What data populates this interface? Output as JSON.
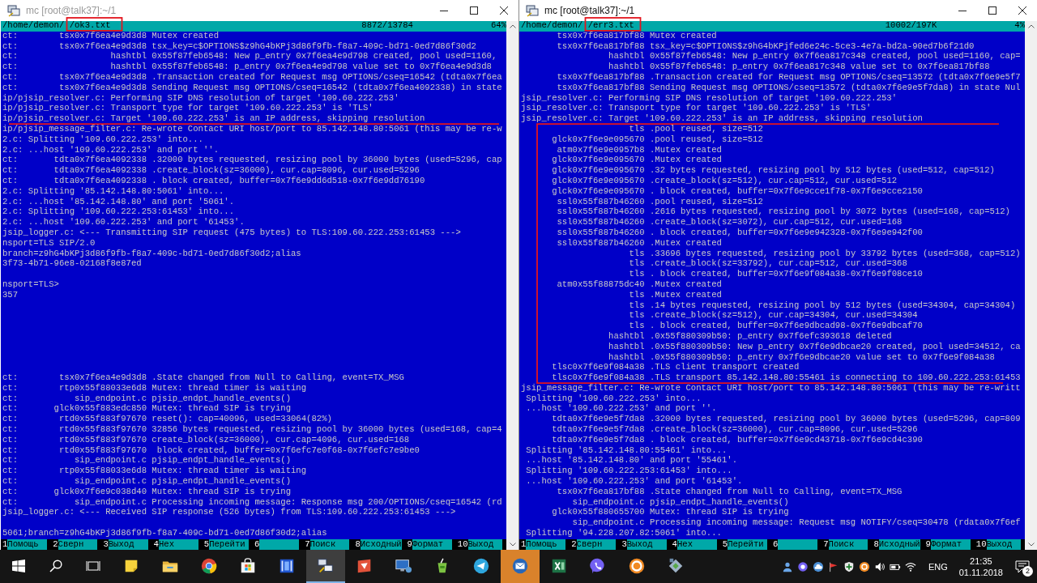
{
  "windows": [
    {
      "title": "mc [root@talk37]:~/1",
      "active": false,
      "header": {
        "path_start": "/home/demon/",
        "path_end": "/ok3.txt",
        "position": "8872/13784",
        "percent": "64%"
      },
      "lines": [
        {
          "kind": "text",
          "text": "ct:        tsx0x7f6ea4e9d3d8 Mutex created"
        },
        {
          "kind": "text",
          "text": "ct:        tsx0x7f6ea4e9d3d8 tsx_key=c$OPTIONS$z9hG4bKPj3d86f9fb-f8a7-409c-bd71-0ed7d86f30d2"
        },
        {
          "kind": "text",
          "text": "ct:                  hashtbl 0x55f87feb6548: New p_entry 0x7f6ea4e9d798 created, pool used=1160,"
        },
        {
          "kind": "text",
          "text": "ct:                  hashtbl 0x55f87feb6548: p_entry 0x7f6ea4e9d798 value set to 0x7f6ea4e9d3d8"
        },
        {
          "kind": "text",
          "text": "ct:        tsx0x7f6ea4e9d3d8 .Transaction created for Request msg OPTIONS/cseq=16542 (tdta0x7f6ea"
        },
        {
          "kind": "text",
          "text": "ct:        tsx0x7f6ea4e9d3d8 Sending Request msg OPTIONS/cseq=16542 (tdta0x7f6ea4092338) in state"
        },
        {
          "kind": "text",
          "text": "ip/pjsip_resolver.c: Performing SIP DNS resolution of target '109.60.222.253'"
        },
        {
          "kind": "text",
          "text": "ip/pjsip_resolver.c: Transport type for target '109.60.222.253' is 'TLS'"
        },
        {
          "kind": "text",
          "text": "ip/pjsip_resolver.c: Target '109.60.222.253' is an IP address, skipping resolution"
        },
        {
          "kind": "text",
          "text": "ip/pjsip_message_filter.c: Re-wrote Contact URI host/port to 85.142.148.80:5061 (this may be re-w"
        },
        {
          "kind": "text",
          "text": "2.c: Splitting '109.60.222.253' into..."
        },
        {
          "kind": "text",
          "text": "2.c: ...host '109.60.222.253' and port ''."
        },
        {
          "kind": "text",
          "text": "ct:       tdta0x7f6ea4092338 .32000 bytes requested, resizing pool by 36000 bytes (used=5296, cap"
        },
        {
          "kind": "text",
          "text": "ct:       tdta0x7f6ea4092338 .create_block(sz=36000), cur.cap=8096, cur.used=5296"
        },
        {
          "kind": "text",
          "text": "ct:       tdta0x7f6ea4092338 . block created, buffer=0x7f6e9dd6d518-0x7f6e9dd76190"
        },
        {
          "kind": "text",
          "text": "2.c: Splitting '85.142.148.80:5061' into..."
        },
        {
          "kind": "text",
          "text": "2.c: ...host '85.142.148.80' and port '5061'."
        },
        {
          "kind": "text",
          "text": "2.c: Splitting '109.60.222.253:61453' into..."
        },
        {
          "kind": "text",
          "text": "2.c: ...host '109.60.222.253' and port '61453'."
        },
        {
          "kind": "text",
          "text": "jsip_logger.c: <--- Transmitting SIP request (475 bytes) to TLS:109.60.222.253:61453 --->"
        },
        {
          "kind": "text",
          "text": "nsport=TLS SIP/2.0"
        },
        {
          "kind": "text",
          "text": "branch=z9hG4bKPj3d86f9fb-f8a7-409c-bd71-0ed7d86f30d2;alias"
        },
        {
          "kind": "text",
          "text": "3f73-4b71-96e8-02168f8e87ed"
        },
        {
          "kind": "blank"
        },
        {
          "kind": "text",
          "text": "nsport=TLS>"
        },
        {
          "kind": "text",
          "text": "357"
        },
        {
          "kind": "blank"
        },
        {
          "kind": "blank"
        },
        {
          "kind": "blank"
        },
        {
          "kind": "blank"
        },
        {
          "kind": "blank"
        },
        {
          "kind": "blank"
        },
        {
          "kind": "blank"
        },
        {
          "kind": "text",
          "text": "ct:        tsx0x7f6ea4e9d3d8 .State changed from Null to Calling, event=TX_MSG"
        },
        {
          "kind": "text",
          "text": "ct:        rtp0x55f88033e6d8 Mutex: thread timer is waiting"
        },
        {
          "kind": "text",
          "text": "ct:           sip_endpoint.c pjsip_endpt_handle_events()"
        },
        {
          "kind": "text",
          "text": "ct:       glck0x55f883edc850 Mutex: thread SIP is trying"
        },
        {
          "kind": "text",
          "text": "ct:        rtd0x55f883f97670 reset(): cap=40096, used=33064(82%)"
        },
        {
          "kind": "text",
          "text": "ct:        rtd0x55f883f97670 32856 bytes requested, resizing pool by 36000 bytes (used=168, cap=4"
        },
        {
          "kind": "text",
          "text": "ct:        rtd0x55f883f97670 create_block(sz=36000), cur.cap=4096, cur.used=168"
        },
        {
          "kind": "text",
          "text": "ct:        rtd0x55f883f97670  block created, buffer=0x7f6efc7e0f68-0x7f6efc7e9be0"
        },
        {
          "kind": "text",
          "text": "ct:           sip_endpoint.c pjsip_endpt_handle_events()"
        },
        {
          "kind": "text",
          "text": "ct:        rtp0x55f88033e6d8 Mutex: thread timer is waiting"
        },
        {
          "kind": "text",
          "text": "ct:           sip_endpoint.c pjsip_endpt_handle_events()"
        },
        {
          "kind": "text",
          "text": "ct:       glck0x7f6e9c038d40 Mutex: thread SIP is trying"
        },
        {
          "kind": "text",
          "text": "ct:           sip_endpoint.c Processing incoming message: Response msg 200/OPTIONS/cseq=16542 (rd"
        },
        {
          "kind": "text",
          "text": "jsip_logger.c: <--- Received SIP response (526 bytes) from TLS:109.60.222.253:61453 --->"
        },
        {
          "kind": "blank"
        },
        {
          "kind": "text",
          "text": "5061;branch=z9hG4bKPj3d86f9fb-f8a7-409c-bd71-0ed7d86f30d2;alias"
        }
      ],
      "fkeys": [
        {
          "number": "1",
          "label": "Помощь"
        },
        {
          "number": "2",
          "label": "Сверн"
        },
        {
          "number": "3",
          "label": "Выход"
        },
        {
          "number": "4",
          "label": "Hex"
        },
        {
          "number": "5",
          "label": "Перейти"
        },
        {
          "number": "6"
        },
        {
          "number": "7",
          "label": "Поиск"
        },
        {
          "number": "8",
          "label": "Исходный"
        },
        {
          "number": "9",
          "label": "Формат"
        },
        {
          "number": "10",
          "label": "Выход"
        }
      ],
      "marks": [
        {
          "kind": "frame"
        },
        {
          "kind": "underline"
        }
      ]
    },
    {
      "title": "mc [root@talk37]:~/1",
      "active": true,
      "header": {
        "path_start": "/home/demon/",
        "path_end": "/err3.txt",
        "position": "10002/197K",
        "percent": "4%"
      },
      "lines": [
        {
          "kind": "text",
          "text": "       tsx0x7f6ea817bf88 Mutex created"
        },
        {
          "kind": "text",
          "text": "       tsx0x7f6ea817bf88 tsx_key=c$OPTIONS$z9hG4bKPjfed6e24c-5ce3-4e7a-bd2a-90ed7b6f21d0"
        },
        {
          "kind": "text",
          "text": "                 hashtbl 0x55f87feb6548: New p_entry 0x7f6ea817c348 created, pool used=1160, cap="
        },
        {
          "kind": "text",
          "text": "                 hashtbl 0x55f87feb6548: p_entry 0x7f6ea817c348 value set to 0x7f6ea817bf88"
        },
        {
          "kind": "text",
          "text": "       tsx0x7f6ea817bf88 .Transaction created for Request msg OPTIONS/cseq=13572 (tdta0x7f6e9e5f7"
        },
        {
          "kind": "text",
          "text": "       tsx0x7f6ea817bf88 Sending Request msg OPTIONS/cseq=13572 (tdta0x7f6e9e5f7da8) in state Nul"
        },
        {
          "kind": "text",
          "text": "jsip_resolver.c: Performing SIP DNS resolution of target '109.60.222.253'"
        },
        {
          "kind": "text",
          "text": "jsip_resolver.c: Transport type for target '109.60.222.253' is 'TLS'"
        },
        {
          "kind": "text",
          "text": "jsip_resolver.c: Target '109.60.222.253' is an IP address, skipping resolution"
        },
        {
          "kind": "text",
          "text": "                     tls .pool reused, size=512"
        },
        {
          "kind": "text",
          "text": "      glck0x7f6e9e095670 .pool reused, size=512"
        },
        {
          "kind": "text",
          "text": "       atm0x7f6e9e0957b8 .Mutex created"
        },
        {
          "kind": "text",
          "text": "      glck0x7f6e9e095670 .Mutex created"
        },
        {
          "kind": "text",
          "text": "      glck0x7f6e9e095670 .32 bytes requested, resizing pool by 512 bytes (used=512, cap=512)"
        },
        {
          "kind": "text",
          "text": "      glck0x7f6e9e095670 .create_block(sz=512), cur.cap=512, cur.used=512"
        },
        {
          "kind": "text",
          "text": "      glck0x7f6e9e095670 . block created, buffer=0x7f6e9cce1f78-0x7f6e9cce2150"
        },
        {
          "kind": "text",
          "text": "       ssl0x55f887b46260 .pool reused, size=512"
        },
        {
          "kind": "text",
          "text": "       ssl0x55f887b46260 .2616 bytes requested, resizing pool by 3072 bytes (used=168, cap=512)"
        },
        {
          "kind": "text",
          "text": "       ssl0x55f887b46260 .create_block(sz=3072), cur.cap=512, cur.used=168"
        },
        {
          "kind": "text",
          "text": "       ssl0x55f887b46260 . block created, buffer=0x7f6e9e942328-0x7f6e9e942f00"
        },
        {
          "kind": "text",
          "text": "       ssl0x55f887b46260 .Mutex created"
        },
        {
          "kind": "text",
          "text": "                     tls .33696 bytes requested, resizing pool by 33792 bytes (used=368, cap=512)"
        },
        {
          "kind": "text",
          "text": "                     tls .create_block(sz=33792), cur.cap=512, cur.used=368"
        },
        {
          "kind": "text",
          "text": "                     tls . block created, buffer=0x7f6e9f084a38-0x7f6e9f08ce10"
        },
        {
          "kind": "text",
          "text": "       atm0x55f88875dc40 .Mutex created"
        },
        {
          "kind": "text",
          "text": "                     tls .Mutex created"
        },
        {
          "kind": "text",
          "text": "                     tls .14 bytes requested, resizing pool by 512 bytes (used=34304, cap=34304)"
        },
        {
          "kind": "text",
          "text": "                     tls .create_block(sz=512), cur.cap=34304, cur.used=34304"
        },
        {
          "kind": "text",
          "text": "                     tls . block created, buffer=0x7f6e9dbcad98-0x7f6e9dbcaf70"
        },
        {
          "kind": "text",
          "text": "                 hashtbl .0x55f880309b50: p_entry 0x7f6efc393618 deleted"
        },
        {
          "kind": "text",
          "text": "                 hashtbl .0x55f880309b50: New p_entry 0x7f6e9dbcae20 created, pool used=34512, ca"
        },
        {
          "kind": "text",
          "text": "                 hashtbl .0x55f880309b50: p_entry 0x7f6e9dbcae20 value set to 0x7f6e9f084a38"
        },
        {
          "kind": "text",
          "text": "      tlsc0x7f6e9f084a38 .TLS client transport created"
        },
        {
          "kind": "text",
          "text": "      tlsc0x7f6e9f084a38 .TLS transport 85.142.148.80:55461 is connecting to 109.60.222.253:61453"
        },
        {
          "kind": "text",
          "text": "jsip_message_filter.c: Re-wrote Contact URI host/port to 85.142.148.80:5061 (this may be re-writt"
        },
        {
          "kind": "text",
          "text": " Splitting '109.60.222.253' into..."
        },
        {
          "kind": "text",
          "text": " ...host '109.60.222.253' and port ''."
        },
        {
          "kind": "text",
          "text": "      tdta0x7f6e9e5f7da8 .32000 bytes requested, resizing pool by 36000 bytes (used=5296, cap=809"
        },
        {
          "kind": "text",
          "text": "      tdta0x7f6e9e5f7da8 .create_block(sz=36000), cur.cap=8096, cur.used=5296"
        },
        {
          "kind": "text",
          "text": "      tdta0x7f6e9e5f7da8 . block created, buffer=0x7f6e9cd43718-0x7f6e9cd4c390"
        },
        {
          "kind": "text",
          "text": " Splitting '85.142.148.80:55461' into..."
        },
        {
          "kind": "text",
          "text": " ...host '85.142.148.80' and port '55461'."
        },
        {
          "kind": "text",
          "text": " Splitting '109.60.222.253:61453' into..."
        },
        {
          "kind": "text",
          "text": " ...host '109.60.222.253' and port '61453'."
        },
        {
          "kind": "text",
          "text": "       tsx0x7f6ea817bf88 .State changed from Null to Calling, event=TX_MSG"
        },
        {
          "kind": "text",
          "text": "          sip_endpoint.c pjsip_endpt_handle_events()"
        },
        {
          "kind": "text",
          "text": "      glck0x55f880655700 Mutex: thread SIP is trying"
        },
        {
          "kind": "text",
          "text": "          sip_endpoint.c Processing incoming message: Request msg NOTIFY/cseq=30478 (rdata0x7f6ef"
        },
        {
          "kind": "text",
          "text": " Splitting '94.228.207.82:5061' into..."
        }
      ],
      "fkeys": [
        {
          "number": "1",
          "label": "Помощь"
        },
        {
          "number": "2",
          "label": "Сверн"
        },
        {
          "number": "3",
          "label": "Выход"
        },
        {
          "number": "4",
          "label": "Hex"
        },
        {
          "number": "5",
          "label": "Перейти"
        },
        {
          "number": "6"
        },
        {
          "number": "7",
          "label": "Поиск"
        },
        {
          "number": "8",
          "label": "Исходный"
        },
        {
          "number": "9",
          "label": "Формат"
        },
        {
          "number": "10",
          "label": "Выход"
        }
      ],
      "marks": [
        {
          "kind": "frame"
        },
        {
          "kind": "bracket"
        }
      ]
    }
  ],
  "taskbar": {
    "items": [
      {
        "kind": "start",
        "active": false,
        "flashing": false
      },
      {
        "kind": "search",
        "active": false,
        "flashing": false
      },
      {
        "kind": "taskview",
        "active": false,
        "flashing": false
      },
      {
        "kind": "note",
        "active": false,
        "flashing": false
      },
      {
        "kind": "folder",
        "active": false,
        "flashing": false
      },
      {
        "kind": "browser",
        "active": false,
        "flashing": false
      },
      {
        "kind": "bag",
        "active": false,
        "flashing": false
      },
      {
        "kind": "film",
        "active": false,
        "flashing": false
      },
      {
        "kind": "computers",
        "active": true,
        "flashing": false
      },
      {
        "kind": "slides",
        "active": false,
        "flashing": false
      },
      {
        "kind": "monitor",
        "active": false,
        "flashing": false
      },
      {
        "kind": "cup",
        "active": false,
        "flashing": false
      },
      {
        "kind": "plane",
        "active": false,
        "flashing": false
      },
      {
        "kind": "mail",
        "active": false,
        "flashing": true
      },
      {
        "kind": "sheet",
        "active": false,
        "flashing": false
      },
      {
        "kind": "phone",
        "active": false,
        "flashing": false
      },
      {
        "kind": "ring",
        "active": false,
        "flashing": false
      },
      {
        "kind": "map",
        "active": false,
        "flashing": false
      }
    ],
    "tray": {
      "icons": [
        {
          "kind": "person"
        },
        {
          "kind": "chat"
        },
        {
          "kind": "cloud"
        },
        {
          "kind": "flag"
        },
        {
          "kind": "shield"
        },
        {
          "kind": "ring"
        },
        {
          "kind": "speaker"
        },
        {
          "kind": "battery"
        },
        {
          "kind": "wifi"
        }
      ],
      "language": "ENG",
      "time": "21:35",
      "date": "01.11.2018",
      "notifications": "2"
    }
  }
}
